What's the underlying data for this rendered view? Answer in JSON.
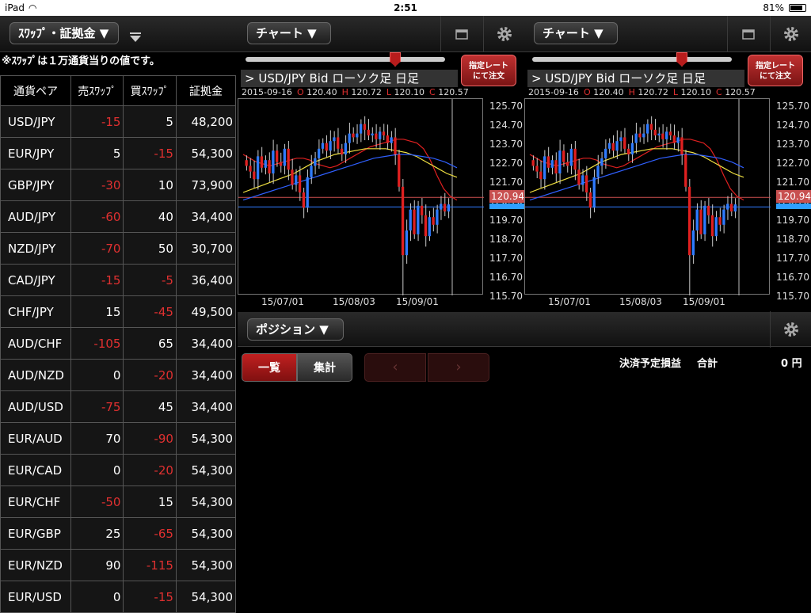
{
  "status": {
    "device": "iPad",
    "time": "2:51",
    "battery": "81%",
    "battery_level": 0.81
  },
  "left": {
    "dropdown": "ｽﾜｯﾌﾟ・証拠金 ▼",
    "note": "※ｽﾜｯﾌﾟは１万通貨当りの値です。",
    "columns": [
      "通貨ペア",
      "売ｽﾜｯﾌﾟ",
      "買ｽﾜｯﾌﾟ",
      "証拠金"
    ],
    "rows": [
      {
        "pair": "USD/JPY",
        "sell": "-15",
        "buy": "5",
        "margin": "48,200"
      },
      {
        "pair": "EUR/JPY",
        "sell": "5",
        "buy": "-15",
        "margin": "54,300"
      },
      {
        "pair": "GBP/JPY",
        "sell": "-30",
        "buy": "10",
        "margin": "73,900"
      },
      {
        "pair": "AUD/JPY",
        "sell": "-60",
        "buy": "40",
        "margin": "34,400"
      },
      {
        "pair": "NZD/JPY",
        "sell": "-70",
        "buy": "50",
        "margin": "30,700"
      },
      {
        "pair": "CAD/JPY",
        "sell": "-15",
        "buy": "-5",
        "margin": "36,400"
      },
      {
        "pair": "CHF/JPY",
        "sell": "15",
        "buy": "-45",
        "margin": "49,500"
      },
      {
        "pair": "AUD/CHF",
        "sell": "-105",
        "buy": "65",
        "margin": "34,400"
      },
      {
        "pair": "AUD/NZD",
        "sell": "0",
        "buy": "-20",
        "margin": "34,400"
      },
      {
        "pair": "AUD/USD",
        "sell": "-75",
        "buy": "45",
        "margin": "34,400"
      },
      {
        "pair": "EUR/AUD",
        "sell": "70",
        "buy": "-90",
        "margin": "54,300"
      },
      {
        "pair": "EUR/CAD",
        "sell": "0",
        "buy": "-20",
        "margin": "54,300"
      },
      {
        "pair": "EUR/CHF",
        "sell": "-50",
        "buy": "15",
        "margin": "54,300"
      },
      {
        "pair": "EUR/GBP",
        "sell": "25",
        "buy": "-65",
        "margin": "54,300"
      },
      {
        "pair": "EUR/NZD",
        "sell": "90",
        "buy": "-115",
        "margin": "54,300"
      },
      {
        "pair": "EUR/USD",
        "sell": "0",
        "buy": "-15",
        "margin": "54,300"
      }
    ]
  },
  "chart_panel": {
    "dropdown": "チャート ▼",
    "rate_button": "指定レート\nにて注文",
    "title": "> USD/JPY   Bid  ローソク足 日足",
    "date": "2015-09-16",
    "open": "120.40",
    "high": "120.72",
    "low": "120.10",
    "close": "120.57",
    "ohlc_labels": {
      "o": "O",
      "h": "H",
      "l": "L",
      "c": "C"
    },
    "current_price": "120.94"
  },
  "chart_data": {
    "type": "candlestick",
    "y_ticks": [
      "125.70",
      "124.70",
      "123.70",
      "122.70",
      "121.70",
      "120.70",
      "119.70",
      "118.70",
      "117.70",
      "116.70",
      "115.70"
    ],
    "ylim": [
      115.7,
      125.7
    ],
    "x_ticks": [
      "15/07/01",
      "15/08/03",
      "15/09/01"
    ],
    "current": 120.94,
    "close_series": [
      122.6,
      122.3,
      121.9,
      123.1,
      122.5,
      122.9,
      122.2,
      123.4,
      122.8,
      122.6,
      123.5,
      122.4,
      121.6,
      122.1,
      121.2,
      120.4,
      122.0,
      122.6,
      123.0,
      123.5,
      123.8,
      123.4,
      123.9,
      124.1,
      123.5,
      123.2,
      123.8,
      124.3,
      124.1,
      124.3,
      124.8,
      124.5,
      124.2,
      124.3,
      124.0,
      124.4,
      124.2,
      123.8,
      124.1,
      123.2,
      121.5,
      117.9,
      119.2,
      120.3,
      119.0,
      120.5,
      120.0,
      118.9,
      119.9,
      119.5,
      120.3,
      120.6,
      120.2,
      120.57
    ],
    "series": [
      {
        "color": "#e02020",
        "values": [
          123.2,
          123.0,
          122.8,
          122.7,
          122.6,
          122.7,
          122.8,
          122.9,
          123.0,
          123.0,
          122.9,
          122.7,
          122.6,
          122.5,
          122.6,
          122.8,
          123.0,
          123.2,
          123.4,
          123.6,
          123.7,
          123.8,
          123.9,
          124.0,
          124.0,
          123.9,
          123.8,
          123.5,
          122.9,
          122.1,
          121.4,
          121.0,
          120.8
        ]
      },
      {
        "color": "#f0e040",
        "values": [
          121.2,
          121.4,
          121.6,
          121.8,
          122.0,
          122.2,
          122.5,
          122.8,
          123.0,
          123.2,
          123.3,
          123.4,
          123.5,
          123.5,
          123.5,
          123.4,
          123.3,
          123.1,
          122.8,
          122.5,
          122.2,
          122.0
        ]
      },
      {
        "color": "#3060ff",
        "values": [
          120.8,
          121.0,
          121.2,
          121.4,
          121.6,
          121.8,
          122.0,
          122.2,
          122.4,
          122.6,
          122.8,
          123.0,
          123.1,
          123.2,
          123.2,
          123.1,
          123.0,
          122.8,
          122.5
        ]
      }
    ]
  },
  "position": {
    "dropdown": "ポジション ▼",
    "tab_list": "一覧",
    "tab_total": "集計",
    "prev": "‹",
    "next": "›",
    "pl_label": "決済予定損益",
    "sum_label": "合計",
    "amount": "0 円"
  },
  "colors": {
    "accent": "#c02020",
    "up": "#2f7bff",
    "down": "#e02020"
  }
}
